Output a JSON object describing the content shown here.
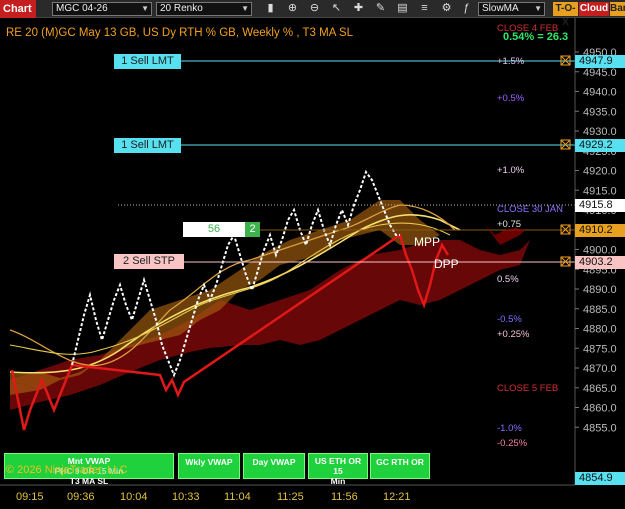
{
  "toolbar": {
    "chart_label": "Chart",
    "instrument": "MGC 04-26",
    "bar_type": "20 Renko",
    "indicator_select": "SlowMA",
    "tdx_label": "T-O-X",
    "cloud_label": "Cloud",
    "bar_label": "Bar"
  },
  "chart": {
    "title": "RE 20  (M)GC May 13 GB, US Dy RTH % GB, Weekly % , T3 MA SL",
    "percent_readout": "0.54% = 26.3",
    "copyright": "© 2026 NinjaTrader, LLC"
  },
  "orders": [
    {
      "label": "1 Sell LMT",
      "price": "4947.9"
    },
    {
      "label": "1 Sell LMT",
      "price": "4929.2"
    },
    {
      "label": "2 Sell STP",
      "price": "4903.2"
    }
  ],
  "position": {
    "pnl": "56",
    "qty": "2"
  },
  "price_tags": {
    "last": "4915.8",
    "level_1": "4910.2",
    "bottom": "4854.9"
  },
  "levels": [
    {
      "text": "CLOSE 4 FEB",
      "color": "#d23030"
    },
    {
      "text": "+1.5%",
      "color": "#e0c0f0"
    },
    {
      "text": "+0.5%",
      "color": "#a060ff"
    },
    {
      "text": "+1.0%",
      "color": "#f0d0f0"
    },
    {
      "text": "CLOSE 30 JAN",
      "color": "#9070ff"
    },
    {
      "text": "+0.75",
      "color": "#e0e0e0"
    },
    {
      "text": "0.5%",
      "color": "#f0d0f0"
    },
    {
      "text": "-0.5%",
      "color": "#8070ff"
    },
    {
      "text": "+0.25%",
      "color": "#f0c0d0"
    },
    {
      "text": "CLOSE 5 FEB",
      "color": "#d23030"
    },
    {
      "text": "-1.0%",
      "color": "#8070ff"
    },
    {
      "text": "-0.25%",
      "color": "#f080a0"
    }
  ],
  "pivots": {
    "mpp": "MPP",
    "dpp": "DPP"
  },
  "y_axis_ticks": [
    "4950.0",
    "4945.0",
    "4940.0",
    "4935.0",
    "4930.0",
    "4925.0",
    "4920.0",
    "4915.0",
    "4910.0",
    "4905.0",
    "4900.0",
    "4895.0",
    "4890.0",
    "4885.0",
    "4880.0",
    "4875.0",
    "4870.0",
    "4865.0",
    "4860.0",
    "4855.0"
  ],
  "x_axis_ticks": [
    "09:15",
    "09:36",
    "10:04",
    "10:33",
    "11:04",
    "11:25",
    "11:56",
    "12:21"
  ],
  "vwap_buttons": [
    {
      "line1": "Mnt VWAP",
      "line2": "PHC 9 OR 15 Min",
      "line3": "T3 MA SL"
    },
    {
      "line1": "Wkly VWAP"
    },
    {
      "line1": "Day VWAP"
    },
    {
      "line1": "US ETH OR 15",
      "line2": "Min"
    },
    {
      "line1": "GC RTH OR"
    }
  ],
  "colors": {
    "accent_red": "#c41e1e",
    "order_cyan": "#57e0f0",
    "stop_pink": "#f8c4c4",
    "renko_white": "#ffffff",
    "vwap_green": "#1ed13d"
  }
}
